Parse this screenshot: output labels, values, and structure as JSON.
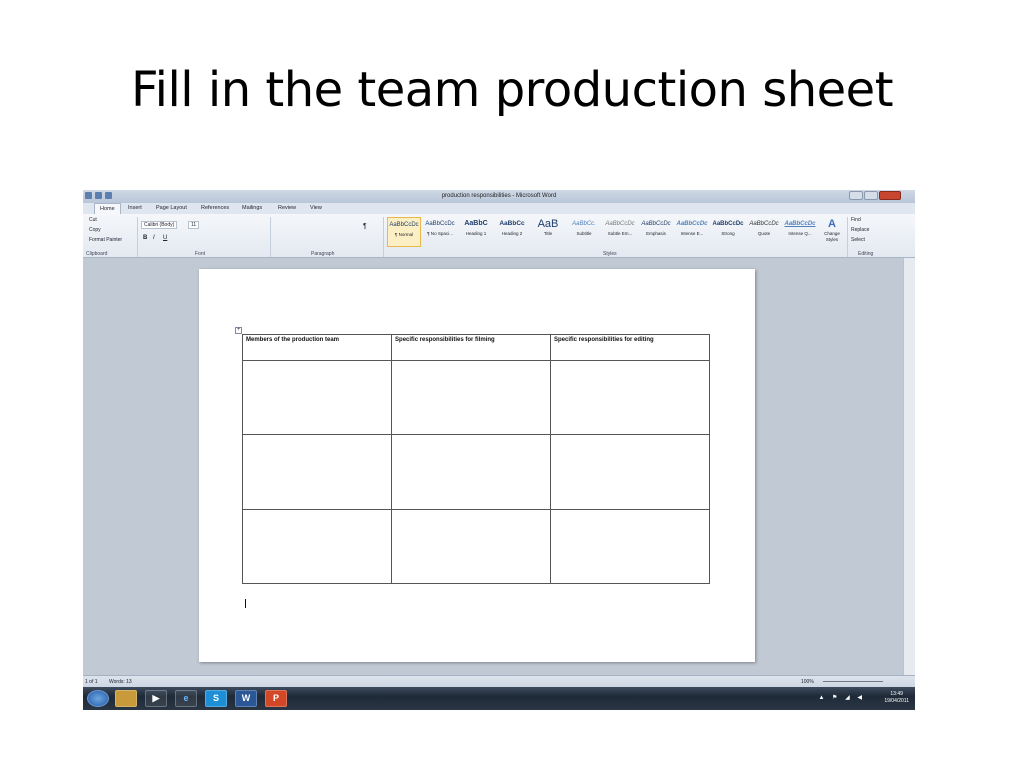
{
  "slide": {
    "title": "Fill in the team production sheet"
  },
  "window": {
    "title": "production responsibilities - Microsoft Word"
  },
  "tabs": [
    "Home",
    "Insert",
    "Page Layout",
    "References",
    "Mailings",
    "Review",
    "View"
  ],
  "clipboard": {
    "cut": "Cut",
    "copy": "Copy",
    "format_painter": "Format Painter",
    "label": "Clipboard"
  },
  "font": {
    "name": "Calibri (Body)",
    "size": "11",
    "label": "Font",
    "bold": "B",
    "italic": "I",
    "underline": "U"
  },
  "paragraph": {
    "label": "Paragraph",
    "pilcrow": "¶"
  },
  "styles": {
    "label": "Styles",
    "items": [
      {
        "sample": "AaBbCcDc",
        "name": "¶ Normal"
      },
      {
        "sample": "AaBbCcDc",
        "name": "¶ No Spaci..."
      },
      {
        "sample": "AaBbC",
        "name": "Heading 1"
      },
      {
        "sample": "AaBbCc",
        "name": "Heading 2"
      },
      {
        "sample": "AaB",
        "name": "Title"
      },
      {
        "sample": "AaBbCc.",
        "name": "Subtitle"
      },
      {
        "sample": "AaBbCcDc",
        "name": "Subtle Em..."
      },
      {
        "sample": "AaBbCcDc",
        "name": "Emphasis"
      },
      {
        "sample": "AaBbCcDc",
        "name": "Intense E..."
      },
      {
        "sample": "AaBbCcDc",
        "name": "Strong"
      },
      {
        "sample": "AaBbCcDc",
        "name": "Quote"
      },
      {
        "sample": "AaBbCcDc",
        "name": "Intense Q..."
      }
    ],
    "change_styles": "Change Styles"
  },
  "editing": {
    "find": "Find",
    "replace": "Replace",
    "select": "Select",
    "label": "Editing"
  },
  "table": {
    "headers": [
      "Members of the production team",
      "Specific responsibilities for filming",
      "Specific responsibilities for editing"
    ]
  },
  "status": {
    "page": "1 of 1",
    "words": "Words: 13",
    "zoom": "100%"
  },
  "taskbar": {
    "time": "13:49",
    "date": "19/04/2011"
  }
}
